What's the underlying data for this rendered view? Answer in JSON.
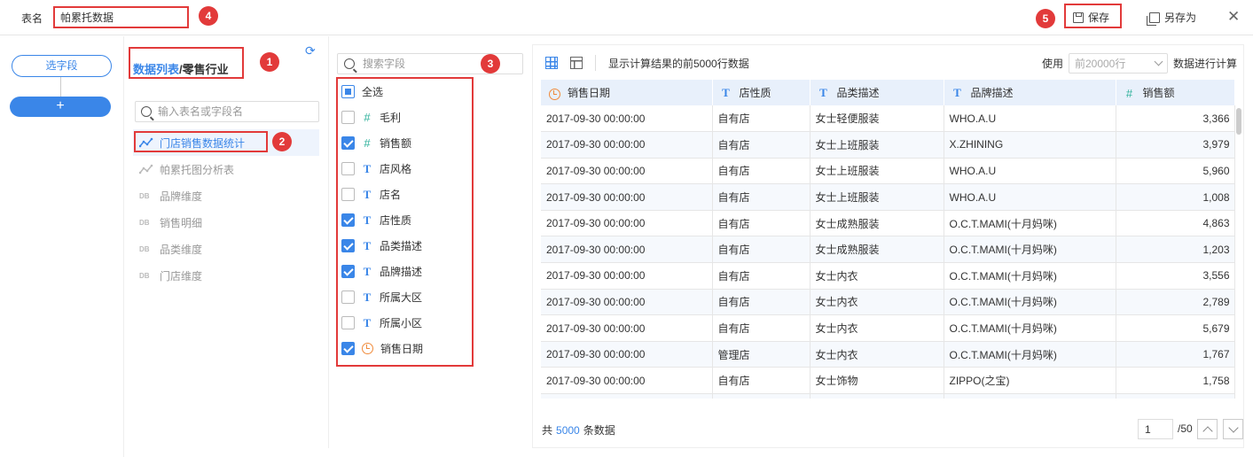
{
  "topbar": {
    "table_name_label": "表名",
    "table_name_value": "帕累托数据",
    "save_label": "保存",
    "save_as_label": "另存为",
    "close_icon": "close-icon"
  },
  "annotations": [
    "1",
    "2",
    "3",
    "4",
    "5"
  ],
  "left_rail": {
    "pick_field_label": "选字段",
    "add_label": "+"
  },
  "data_list": {
    "breadcrumb_link": "数据列表",
    "breadcrumb_sep": "/",
    "breadcrumb_current": "零售行业",
    "search_placeholder": "输入表名或字段名",
    "tables": [
      {
        "label": "门店销售数据统计",
        "icon": "graph-icon",
        "active": true
      },
      {
        "label": "帕累托图分析表",
        "icon": "graph-icon",
        "active": false
      },
      {
        "label": "品牌维度",
        "icon": "db-icon",
        "active": false
      },
      {
        "label": "销售明细",
        "icon": "db-icon",
        "active": false
      },
      {
        "label": "品类维度",
        "icon": "db-icon",
        "active": false
      },
      {
        "label": "门店维度",
        "icon": "db-icon",
        "active": false
      }
    ]
  },
  "fields": {
    "search_placeholder": "搜索字段",
    "select_all_label": "全选",
    "items": [
      {
        "label": "毛利",
        "type": "number",
        "checked": false
      },
      {
        "label": "销售额",
        "type": "number",
        "checked": true
      },
      {
        "label": "店风格",
        "type": "text",
        "checked": false
      },
      {
        "label": "店名",
        "type": "text",
        "checked": false
      },
      {
        "label": "店性质",
        "type": "text",
        "checked": true
      },
      {
        "label": "品类描述",
        "type": "text",
        "checked": true
      },
      {
        "label": "品牌描述",
        "type": "text",
        "checked": true
      },
      {
        "label": "所属大区",
        "type": "text",
        "checked": false
      },
      {
        "label": "所属小区",
        "type": "text",
        "checked": false
      },
      {
        "label": "销售日期",
        "type": "date",
        "checked": true
      }
    ]
  },
  "preview": {
    "info_text": "显示计算结果的前5000行数据",
    "use_label": "使用",
    "rows_select_value": "前20000行",
    "calc_label": "数据进行计算",
    "columns": [
      {
        "label": "销售日期",
        "type": "date"
      },
      {
        "label": "店性质",
        "type": "text"
      },
      {
        "label": "品类描述",
        "type": "text"
      },
      {
        "label": "品牌描述",
        "type": "text"
      },
      {
        "label": "销售额",
        "type": "number"
      }
    ],
    "rows": [
      [
        "2017-09-30 00:00:00",
        "自有店",
        "女士轻便服装",
        "WHO.A.U",
        "3,366"
      ],
      [
        "2017-09-30 00:00:00",
        "自有店",
        "女士上班服装",
        "X.ZHINING",
        "3,979"
      ],
      [
        "2017-09-30 00:00:00",
        "自有店",
        "女士上班服装",
        "WHO.A.U",
        "5,960"
      ],
      [
        "2017-09-30 00:00:00",
        "自有店",
        "女士上班服装",
        "WHO.A.U",
        "1,008"
      ],
      [
        "2017-09-30 00:00:00",
        "自有店",
        "女士成熟服装",
        "O.C.T.MAMI(十月妈咪)",
        "4,863"
      ],
      [
        "2017-09-30 00:00:00",
        "自有店",
        "女士成熟服装",
        "O.C.T.MAMI(十月妈咪)",
        "1,203"
      ],
      [
        "2017-09-30 00:00:00",
        "自有店",
        "女士内衣",
        "O.C.T.MAMI(十月妈咪)",
        "3,556"
      ],
      [
        "2017-09-30 00:00:00",
        "自有店",
        "女士内衣",
        "O.C.T.MAMI(十月妈咪)",
        "2,789"
      ],
      [
        "2017-09-30 00:00:00",
        "自有店",
        "女士内衣",
        "O.C.T.MAMI(十月妈咪)",
        "5,679"
      ],
      [
        "2017-09-30 00:00:00",
        "管理店",
        "女士内衣",
        "O.C.T.MAMI(十月妈咪)",
        "1,767"
      ],
      [
        "2017-09-30 00:00:00",
        "自有店",
        "女士饰物",
        "ZIPPO(之宝)",
        "1,758"
      ],
      [
        "",
        "",
        "",
        "",
        ""
      ]
    ],
    "footer_prefix": "共",
    "footer_count": "5000",
    "footer_suffix": "条数据",
    "page_value": "1",
    "page_total": "/50"
  }
}
